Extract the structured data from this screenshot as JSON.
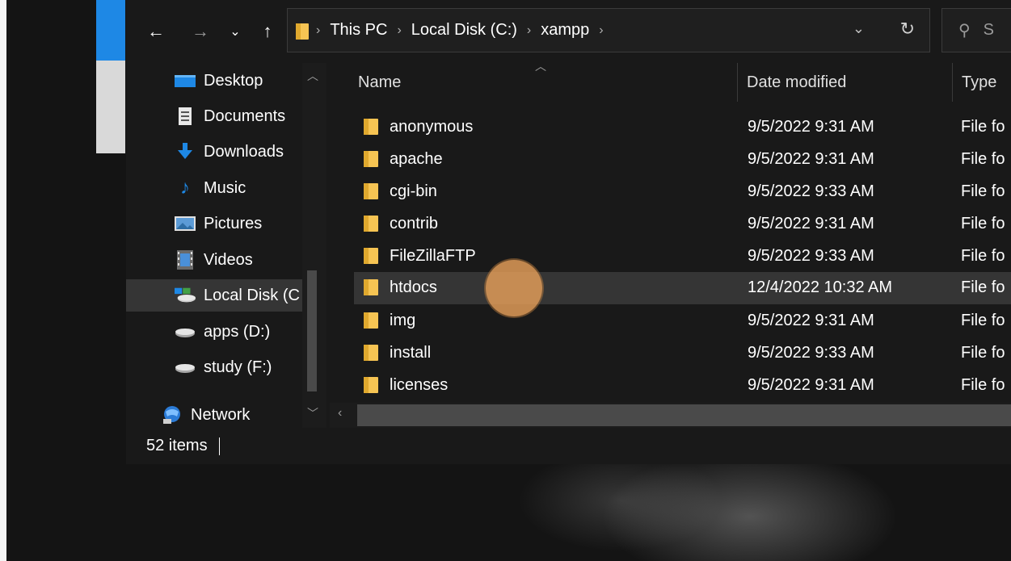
{
  "window": {
    "breadcrumb": [
      "This PC",
      "Local Disk (C:)",
      "xampp"
    ],
    "search_placeholder": "S"
  },
  "nav_pane": {
    "items": [
      {
        "label": "Desktop",
        "icon": "desktop-icon"
      },
      {
        "label": "Documents",
        "icon": "documents-icon"
      },
      {
        "label": "Downloads",
        "icon": "downloads-icon"
      },
      {
        "label": "Music",
        "icon": "music-icon"
      },
      {
        "label": "Pictures",
        "icon": "pictures-icon"
      },
      {
        "label": "Videos",
        "icon": "videos-icon"
      },
      {
        "label": "Local Disk (C",
        "icon": "local-disk-icon",
        "selected": true
      },
      {
        "label": "apps (D:)",
        "icon": "drive-icon"
      },
      {
        "label": "study (F:)",
        "icon": "drive-icon"
      },
      {
        "label": "Network",
        "icon": "network-icon"
      }
    ]
  },
  "columns": {
    "name": "Name",
    "date_modified": "Date modified",
    "type": "Type"
  },
  "files": [
    {
      "name": "anonymous",
      "date": "9/5/2022 9:31 AM",
      "type": "File fo"
    },
    {
      "name": "apache",
      "date": "9/5/2022 9:31 AM",
      "type": "File fo"
    },
    {
      "name": "cgi-bin",
      "date": "9/5/2022 9:33 AM",
      "type": "File fo"
    },
    {
      "name": "contrib",
      "date": "9/5/2022 9:31 AM",
      "type": "File fo"
    },
    {
      "name": "FileZillaFTP",
      "date": "9/5/2022 9:33 AM",
      "type": "File fo"
    },
    {
      "name": "htdocs",
      "date": "12/4/2022 10:32 AM",
      "type": "File fo",
      "hover": true
    },
    {
      "name": "img",
      "date": "9/5/2022 9:31 AM",
      "type": "File fo"
    },
    {
      "name": "install",
      "date": "9/5/2022 9:33 AM",
      "type": "File fo"
    },
    {
      "name": "licenses",
      "date": "9/5/2022 9:31 AM",
      "type": "File fo"
    }
  ],
  "status_bar": {
    "item_count": "52 items"
  },
  "colors": {
    "window_bg": "#191919",
    "selection_bg": "#353535",
    "folder_yellow": "#f6c453",
    "click_marker": "#e6a05a"
  }
}
